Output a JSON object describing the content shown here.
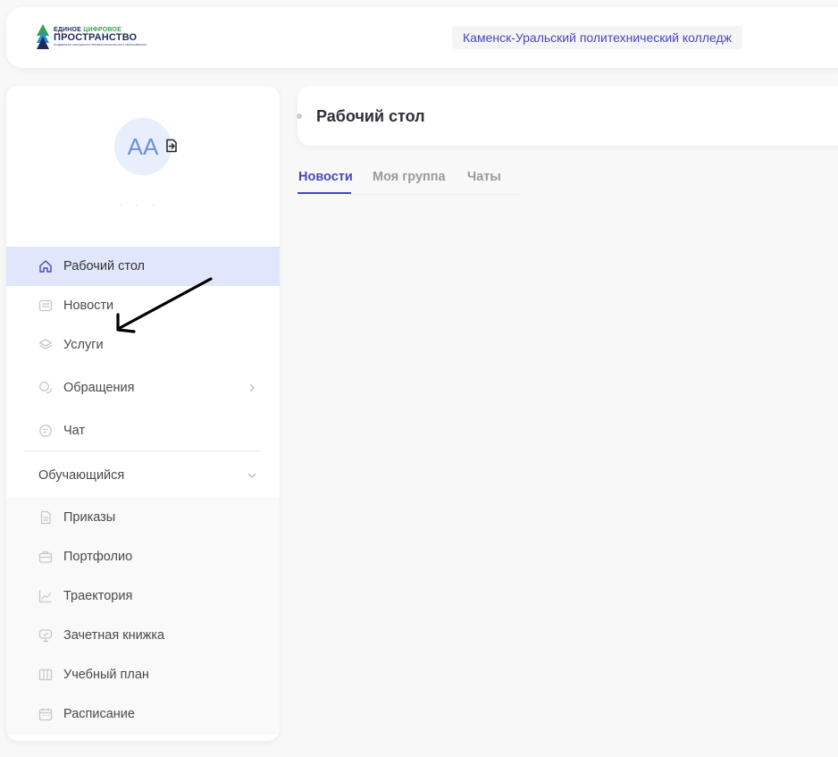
{
  "header": {
    "logo": {
      "line1_a": "ЕДИНОЕ ",
      "line1_b": "ЦИФРОВОЕ",
      "line2": "ПРОСТРАНСТВО",
      "line3": "ПОДДЕРЖКИ НАРОДНОГО ПРОФЕССИОНАЛЬНОГО ОБРАЗОВАНИЯ"
    },
    "college_name": "Каменск-Уральский политехнический колледж"
  },
  "user": {
    "initials": "АА",
    "name_placeholder": "· · ·"
  },
  "sidebar": {
    "items": [
      {
        "label": "Рабочий стол",
        "icon": "home-icon",
        "active": true
      },
      {
        "label": "Новости",
        "icon": "news-icon"
      },
      {
        "label": "Услуги",
        "icon": "layers-icon"
      },
      {
        "label": "Обращения",
        "icon": "chat-bubbles-icon",
        "has_children": true
      },
      {
        "label": "Чат",
        "icon": "chat-icon"
      }
    ],
    "section": {
      "label": "Обучающийся",
      "expanded": true,
      "items": [
        {
          "label": "Приказы",
          "icon": "document-icon"
        },
        {
          "label": "Портфолио",
          "icon": "briefcase-icon"
        },
        {
          "label": "Траектория",
          "icon": "trend-icon"
        },
        {
          "label": "Зачетная книжка",
          "icon": "record-book-icon"
        },
        {
          "label": "Учебный план",
          "icon": "book-icon"
        },
        {
          "label": "Расписание",
          "icon": "calendar-icon"
        }
      ]
    }
  },
  "main": {
    "page_title": "Рабочий стол",
    "tabs": [
      {
        "label": "Новости",
        "active": true
      },
      {
        "label": "Моя группа"
      },
      {
        "label": "Чаты"
      }
    ]
  },
  "colors": {
    "accent": "#4b46b8",
    "active_bg": "#e0e6fb",
    "avatar_bg": "#e7eefc",
    "avatar_text": "#6f8fda",
    "page_bg": "#f8f8f9"
  }
}
